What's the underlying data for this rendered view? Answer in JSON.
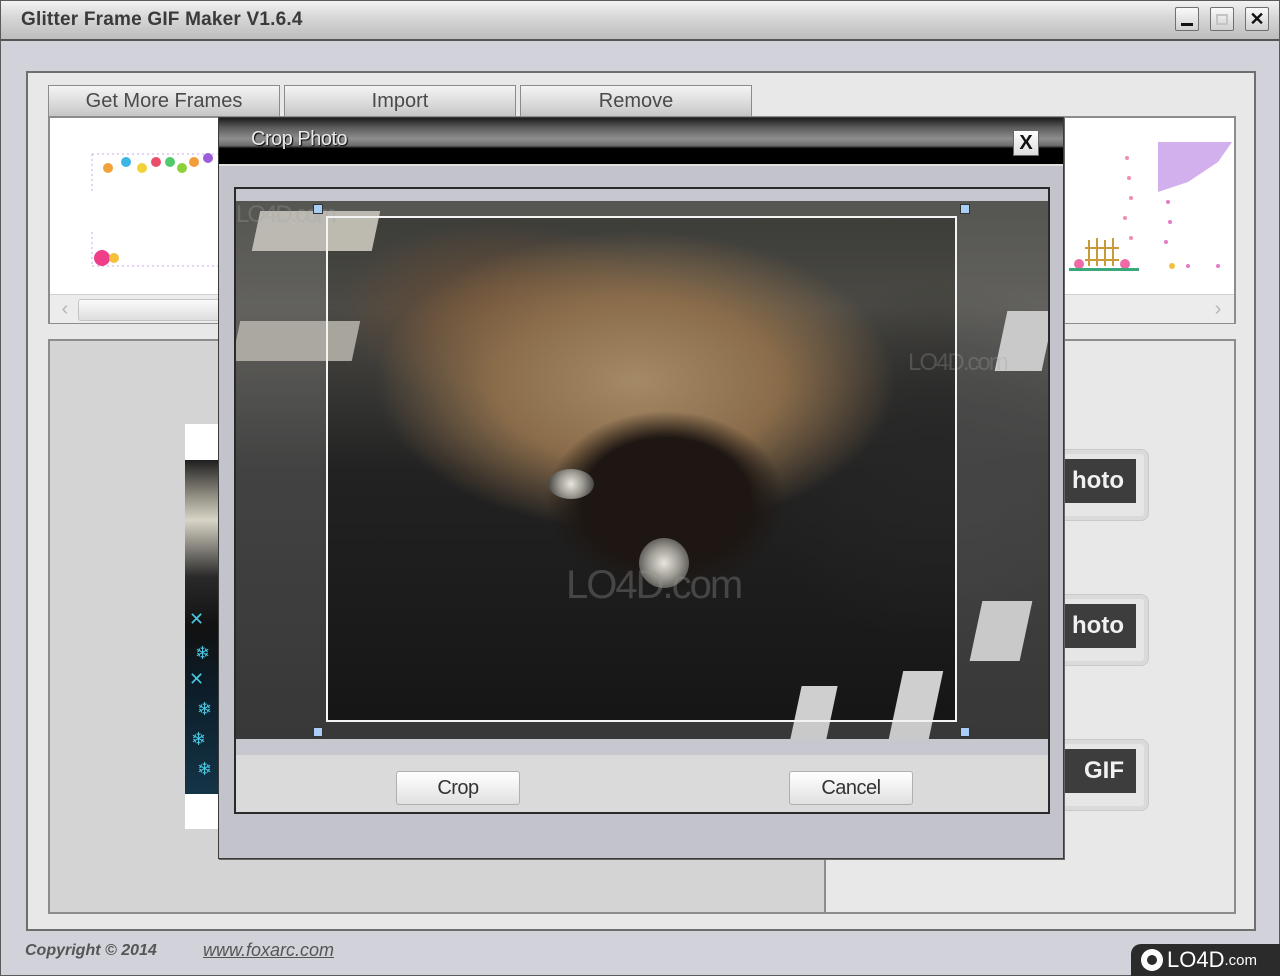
{
  "window": {
    "title": "Glitter Frame GIF Maker V1.6.4",
    "controls": {
      "minimize": "minimize-icon",
      "maximize": "maximize-icon",
      "close_glyph": "✕"
    }
  },
  "toolbar": {
    "tabs": [
      {
        "label": "Get More Frames"
      },
      {
        "label": "Import"
      },
      {
        "label": "Remove"
      }
    ]
  },
  "frames_strip": {
    "scroll_left_glyph": "‹",
    "scroll_right_glyph": "›",
    "thumbnails": [
      "hearts-frame",
      "garden-gate-frame",
      "purple-flowers-frame"
    ]
  },
  "actions": {
    "buttons": [
      {
        "label": "hoto"
      },
      {
        "label": "hoto"
      },
      {
        "label": "GIF"
      }
    ]
  },
  "crop_dialog": {
    "title": "Crop Photo",
    "close_glyph": "X",
    "crop_label": "Crop",
    "cancel_label": "Cancel",
    "watermark": "LO4D.com",
    "handle_color": "#a9cdf5"
  },
  "footer": {
    "copyright": "Copyright © 2014",
    "link": "www.foxarc.com"
  },
  "badge": {
    "brand": "LO4D",
    "suffix": ".com"
  }
}
